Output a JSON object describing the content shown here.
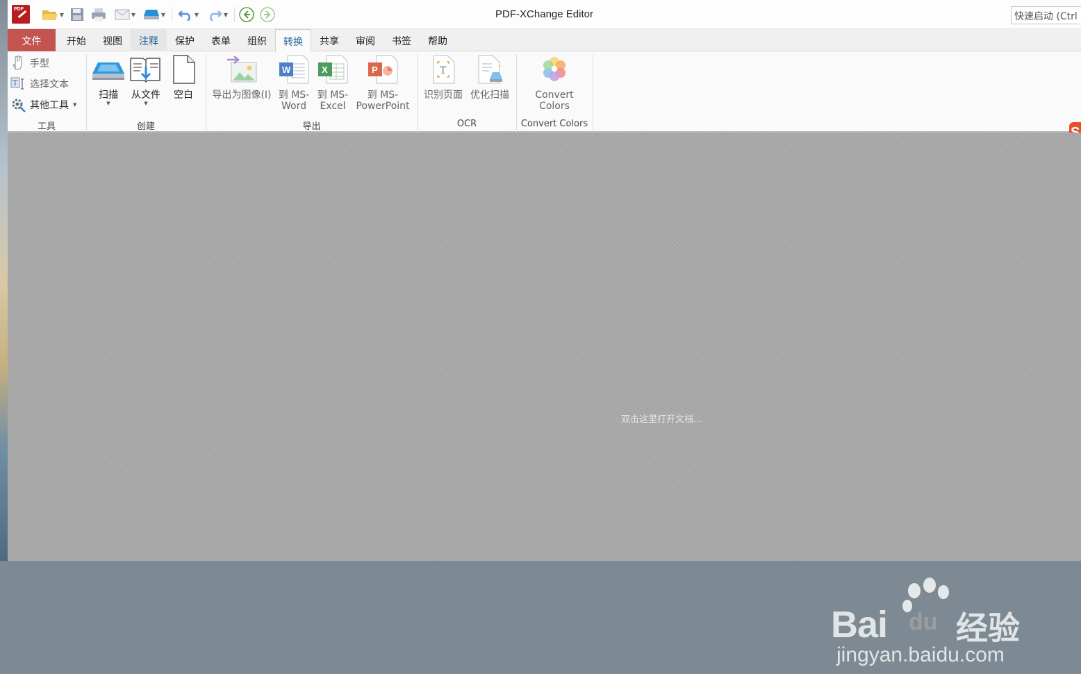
{
  "window": {
    "title": "PDF-XChange Editor",
    "quick_launch_placeholder": "快速启动 (Ctrl"
  },
  "quick_access": {
    "icons": [
      "app-icon",
      "open-folder-icon",
      "save-icon",
      "print-icon",
      "email-icon",
      "scan-icon",
      "undo-icon",
      "redo-icon",
      "back-icon",
      "forward-icon"
    ]
  },
  "tabs": [
    {
      "label": "文件"
    },
    {
      "label": "开始"
    },
    {
      "label": "视图"
    },
    {
      "label": "注释"
    },
    {
      "label": "保护"
    },
    {
      "label": "表单"
    },
    {
      "label": "组织"
    },
    {
      "label": "转换"
    },
    {
      "label": "共享"
    },
    {
      "label": "审阅"
    },
    {
      "label": "书签"
    },
    {
      "label": "帮助"
    }
  ],
  "ribbon": {
    "tools": {
      "label": "工具",
      "hand": "手型",
      "select_text": "选择文本",
      "other_tools": "其他工具"
    },
    "create": {
      "label": "创建",
      "scan": "扫描",
      "from_file": "从文件",
      "blank": "空白"
    },
    "export": {
      "label": "导出",
      "to_image": "导出为图像(I)",
      "word_line1": "到 MS-",
      "word_line2": "Word",
      "excel_line1": "到 MS-",
      "excel_line2": "Excel",
      "ppt_line1": "到 MS-",
      "ppt_line2": "PowerPoint"
    },
    "ocr": {
      "label": "OCR",
      "recognize_page": "识别页面",
      "optimize_scan": "优化扫描"
    },
    "convert_colors": {
      "label": "Convert Colors",
      "button_line1": "Convert",
      "button_line2": "Colors"
    }
  },
  "content": {
    "hint": "双击这里打开文档..."
  },
  "watermark": {
    "brand": "Bai",
    "brand2": "du",
    "cn": "经验",
    "url": "jingyan.baidu.com"
  },
  "colors": {
    "file_tab": "#c4544f",
    "active_tab_text": "#1c5c9e",
    "content_bg": "#a9a9a9"
  }
}
